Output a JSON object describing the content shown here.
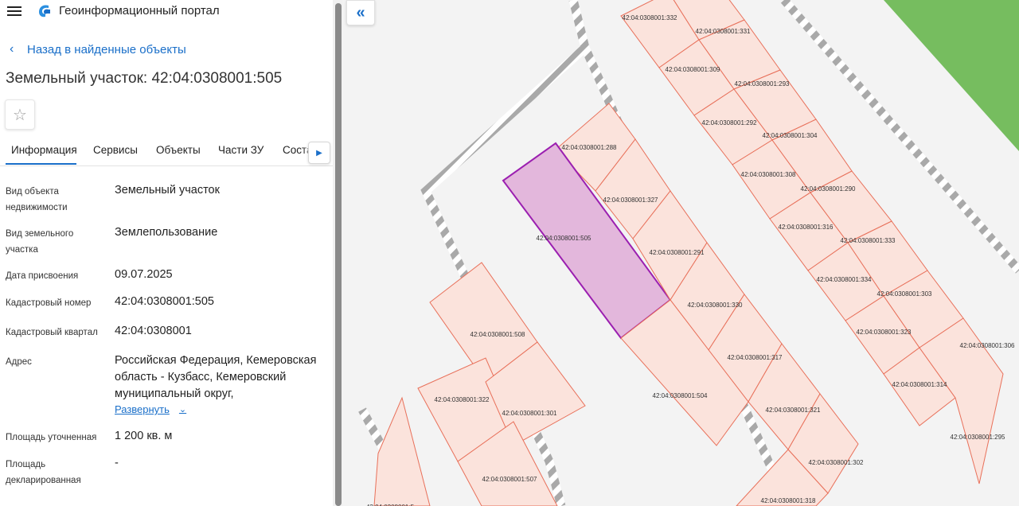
{
  "header": {
    "app_title": "Геоинформационный портал",
    "menu_icon": "hamburger-icon",
    "logo_icon": "portal-logo-icon"
  },
  "nav": {
    "back_label": "Назад в найденные объекты"
  },
  "object": {
    "title": "Земельный участок: 42:04:0308001:505"
  },
  "tabs": [
    {
      "label": "Информация",
      "active": true
    },
    {
      "label": "Сервисы"
    },
    {
      "label": "Объекты"
    },
    {
      "label": "Части ЗУ"
    },
    {
      "label": "Соста"
    }
  ],
  "properties": [
    {
      "label": "Вид объекта недвижимости",
      "value": "Земельный участок"
    },
    {
      "label": "Вид земельного участка",
      "value": "Землепользование"
    },
    {
      "label": "Дата присвоения",
      "value": "09.07.2025"
    },
    {
      "label": "Кадастровый номер",
      "value": "42:04:0308001:505"
    },
    {
      "label": "Кадастровый квартал",
      "value": "42:04:0308001"
    },
    {
      "label": "Адрес",
      "value": "Российская Федерация, Кемеровская область - Кузбасс, Кемеровский муниципальный округ,"
    },
    {
      "label": "Площадь уточненная",
      "value": "1 200 кв. м"
    },
    {
      "label": "Площадь декларированная",
      "value": "-"
    }
  ],
  "expand_label": "Развернуть",
  "map": {
    "colors": {
      "parcel_fill": "#fbe3dc",
      "parcel_stroke": "#e8705a",
      "selected_fill": "#e3b7dc",
      "selected_stroke": "#9b1fb0",
      "forest": "#76bd5f"
    },
    "parcels": [
      "42:04:0308001:332",
      "42:04:0308001:331",
      "42:04:0308001:309",
      "42:04:0308001:293",
      "42:04:0308001:292",
      "42:04:0308001:304",
      "42:04:0308001:308",
      "42:04:0308001:290",
      "42:04:0308001:316",
      "42:04:0308001:333",
      "42:04:0308001:334",
      "42:04:0308001:303",
      "42:04:0308001:323",
      "42:04:0308001:306",
      "42:04:0308001:314",
      "42:04:0308001:295",
      "42:04:0308001:288",
      "42:04:0308001:327",
      "42:04:0308001:505",
      "42:04:0308001:291",
      "42:04:0308001:330",
      "42:04:0308001:317",
      "42:04:0308001:504",
      "42:04:0308001:321",
      "42:04:0308001:302",
      "42:04:0308001:318",
      "42:04:0308001:508",
      "42:04:0308001:322",
      "42:04:0308001:301",
      "42:04:0308001:507",
      "42:04:0308001:5"
    ]
  }
}
